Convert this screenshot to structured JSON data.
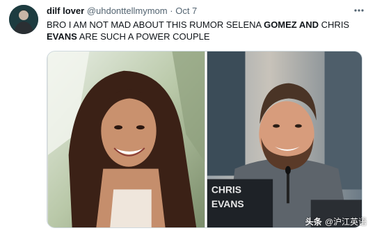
{
  "tweet": {
    "author": {
      "display_name": "dilf lover",
      "handle": "@uhdonttellmymom",
      "separator": "·",
      "date": "Oct 7"
    },
    "more_icon": "more-horizontal-icon",
    "text_parts": [
      "BRO I AM NOT MAD ABOUT THIS RUMOR SELENA ",
      "GOMEZ AND",
      " CHRIS ",
      "EVANS",
      " ARE SUCH A POWER COUPLE"
    ],
    "media": {
      "left_photo": "smiling woman with long dark hair",
      "right_photo": "smiling bearded man at a press conference",
      "nameplate_line1": "CHRIS",
      "nameplate_line2": "EVANS"
    }
  },
  "watermark": {
    "logo_text": "头条",
    "account": "@沪江英语"
  },
  "colors": {
    "text": "#0f1419",
    "secondary": "#536471",
    "border": "#cfd9de"
  }
}
